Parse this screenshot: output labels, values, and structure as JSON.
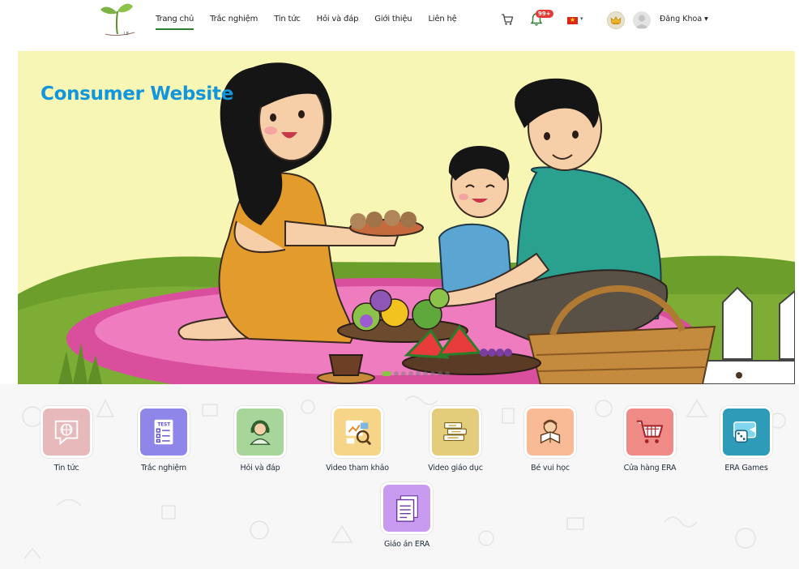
{
  "header": {
    "nav": [
      {
        "label": "Trang chủ",
        "active": true
      },
      {
        "label": "Trắc nghiệm",
        "active": false
      },
      {
        "label": "Tin tức",
        "active": false
      },
      {
        "label": "Hỏi và đáp",
        "active": false
      },
      {
        "label": "Giới thiệu",
        "active": false
      },
      {
        "label": "Liên hệ",
        "active": false
      }
    ],
    "notification_count": "99+",
    "user_name": "Đăng Khoa",
    "icons": {
      "cart": "cart-icon",
      "bell": "bell-icon",
      "flag": "vietnam-flag-icon",
      "crown": "crown-icon",
      "avatar": "user-avatar-icon"
    }
  },
  "banner": {
    "title": "Consumer Website",
    "slide_count": 9,
    "active_slide": 0
  },
  "menu": {
    "tiles": [
      {
        "label": "Tin tức",
        "icon": "news-globe-icon",
        "color": "#e8b9bb"
      },
      {
        "label": "Trắc nghiệm",
        "icon": "test-checklist-icon",
        "color": "#8f86ea"
      },
      {
        "label": "Hỏi và đáp",
        "icon": "support-headset-icon",
        "color": "#a8d59a"
      },
      {
        "label": "Video tham khảo",
        "icon": "video-analysis-icon",
        "color": "#f7d588"
      },
      {
        "label": "Video giáo dục",
        "icon": "books-icon",
        "color": "#e3cd7b"
      },
      {
        "label": "Bé vui học",
        "icon": "child-reading-icon",
        "color": "#f9ba96"
      },
      {
        "label": "Cửa hàng ERA",
        "icon": "shopping-cart-icon",
        "color": "#f08a87"
      },
      {
        "label": "ERA Games",
        "icon": "game-dice-icon",
        "color": "#2e9bb9"
      },
      {
        "label": "Giáo án ERA",
        "icon": "lesson-plan-icon",
        "color": "#c89af0"
      }
    ]
  }
}
